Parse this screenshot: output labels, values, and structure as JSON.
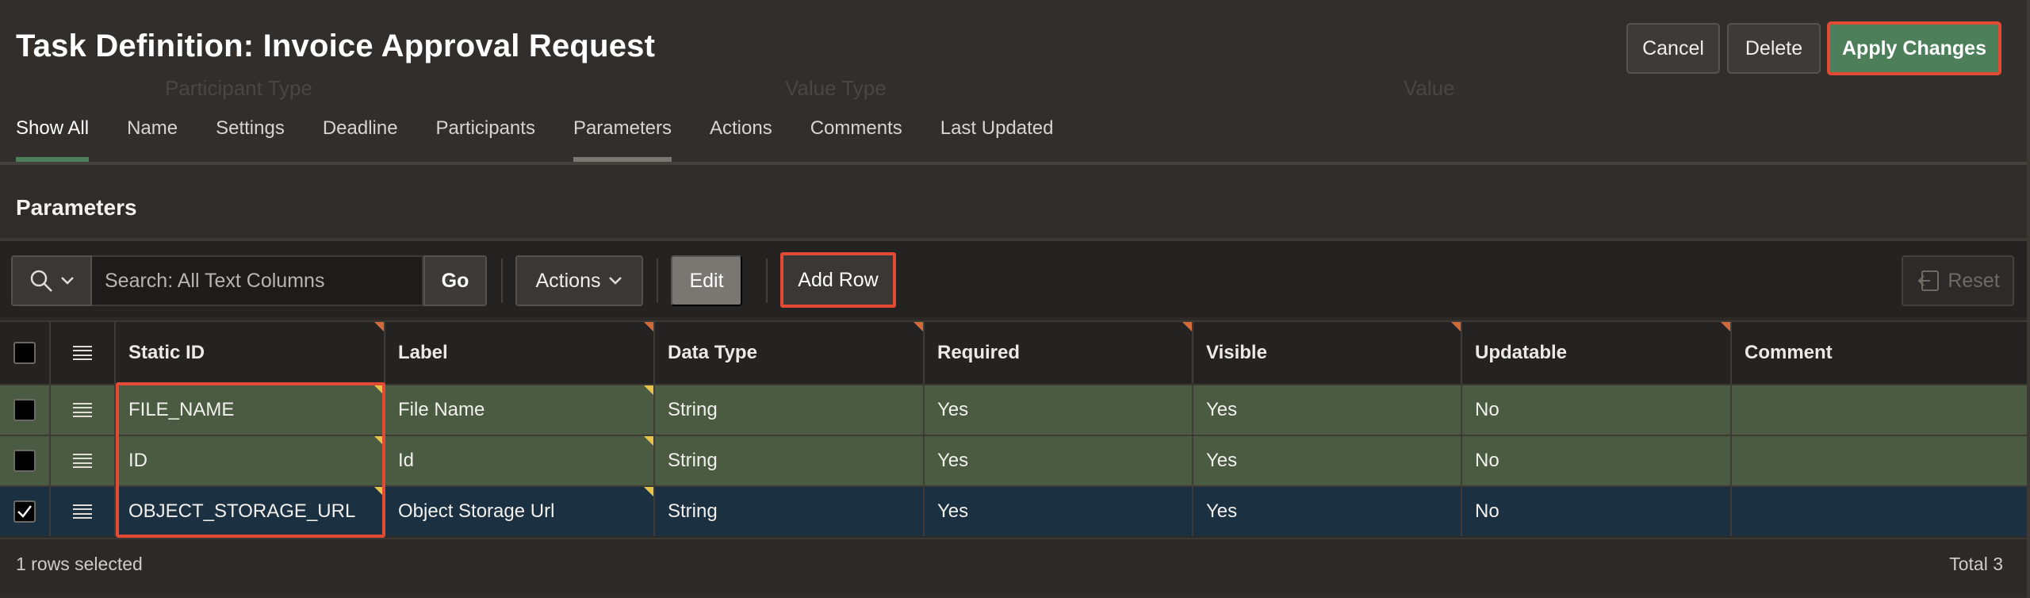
{
  "page": {
    "title": "Task Definition: Invoice Approval Request",
    "buttons": {
      "cancel": "Cancel",
      "delete": "Delete",
      "apply": "Apply Changes"
    },
    "ghost": {
      "participant_type": "Participant Type",
      "value_type": "Value Type",
      "value": "Value"
    }
  },
  "tabs": [
    {
      "label": "Show All",
      "state": "active"
    },
    {
      "label": "Name"
    },
    {
      "label": "Settings"
    },
    {
      "label": "Deadline"
    },
    {
      "label": "Participants"
    },
    {
      "label": "Parameters",
      "state": "selected"
    },
    {
      "label": "Actions"
    },
    {
      "label": "Comments"
    },
    {
      "label": "Last Updated"
    }
  ],
  "region": {
    "title": "Parameters"
  },
  "toolbar": {
    "search_placeholder": "Search: All Text Columns",
    "go": "Go",
    "actions": "Actions",
    "edit": "Edit",
    "add_row": "Add Row",
    "reset": "Reset"
  },
  "grid": {
    "columns": [
      "Static ID",
      "Label",
      "Data Type",
      "Required",
      "Visible",
      "Updatable",
      "Comment"
    ],
    "rows": [
      {
        "static_id": "FILE_NAME",
        "label": "File Name",
        "data_type": "String",
        "required": "Yes",
        "visible": "Yes",
        "updatable": "No",
        "comment": "",
        "selected": false
      },
      {
        "static_id": "ID",
        "label": "Id",
        "data_type": "String",
        "required": "Yes",
        "visible": "Yes",
        "updatable": "No",
        "comment": "",
        "selected": false
      },
      {
        "static_id": "OBJECT_STORAGE_URL",
        "label": "Object Storage Url",
        "data_type": "String",
        "required": "Yes",
        "visible": "Yes",
        "updatable": "No",
        "comment": "",
        "selected": true
      }
    ],
    "footer_selection": "1 rows selected",
    "footer_total": "Total 3"
  },
  "colors": {
    "accent_green": "#4c7f5a",
    "highlight_red": "#e24a33",
    "row_changed": "#4a5b41",
    "row_selected": "#1b3040"
  }
}
